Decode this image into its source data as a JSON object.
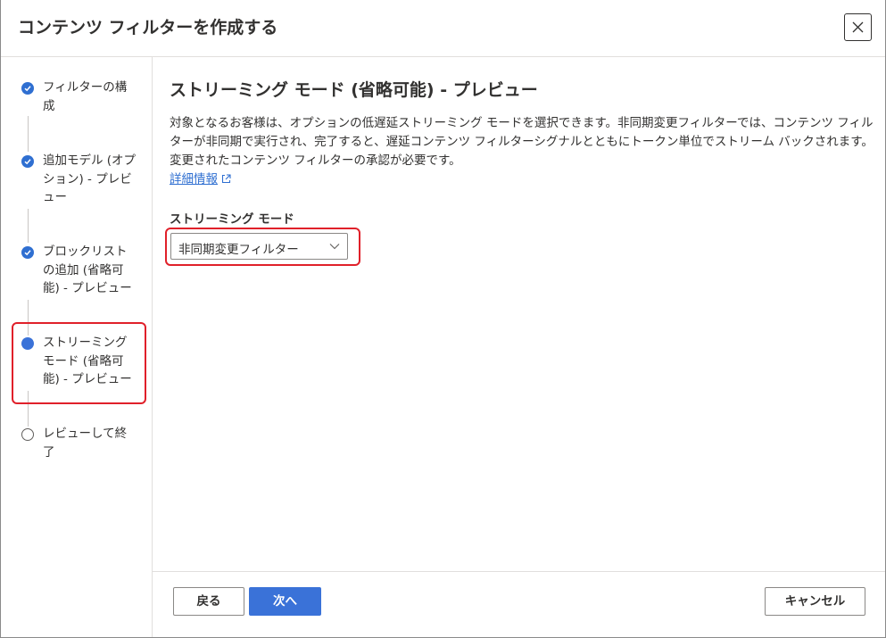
{
  "dialog": {
    "title": "コンテンツ フィルターを作成する"
  },
  "steps": [
    {
      "label": "フィルターの構成",
      "status": "done"
    },
    {
      "label": "追加モデル (オプション) - プレビュー",
      "status": "done"
    },
    {
      "label": "ブロックリストの追加 (省略可能) - プレビュー",
      "status": "done"
    },
    {
      "label": "ストリーミング モード (省略可能) - プレビュー",
      "status": "current"
    },
    {
      "label": "レビューして終了",
      "status": "pending"
    }
  ],
  "main": {
    "section_title": "ストリーミング モード (省略可能) - プレビュー",
    "description": "対象となるお客様は、オプションの低遅延ストリーミング モードを選択できます。非同期変更フィルターでは、コンテンツ フィルターが非同期で実行され、完了すると、遅延コンテンツ フィルターシグナルとともにトークン単位でストリーム バックされます。変更されたコンテンツ フィルターの承認が必要です。",
    "learn_more": "詳細情報",
    "field_label": "ストリーミング モード",
    "dropdown_value": "非同期変更フィルター"
  },
  "footer": {
    "back_label": "戻る",
    "next_label": "次へ",
    "cancel_label": "キャンセル"
  },
  "colors": {
    "accent": "#3a72d8",
    "highlight": "#e0202a"
  }
}
